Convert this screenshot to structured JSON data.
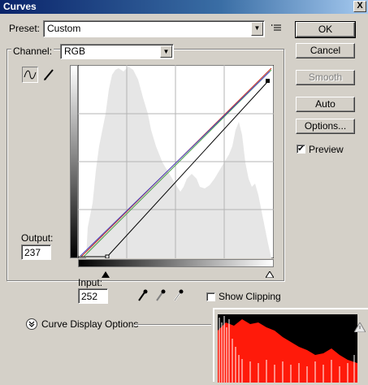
{
  "window": {
    "title": "Curves",
    "close_label": "X"
  },
  "preset": {
    "label": "Preset:",
    "value": "Custom"
  },
  "channel": {
    "label": "Channel:",
    "value": "RGB"
  },
  "buttons": {
    "ok": "OK",
    "cancel": "Cancel",
    "smooth": "Smooth",
    "auto": "Auto",
    "options": "Options..."
  },
  "preview": {
    "label": "Preview",
    "checked": true
  },
  "output": {
    "label": "Output:",
    "value": "237"
  },
  "input": {
    "label": "Input:",
    "value": "252"
  },
  "show_clipping": {
    "label": "Show Clipping",
    "checked": false
  },
  "curve_display_options": {
    "label": "Curve Display Options"
  },
  "colors": {
    "histogram": "#e6e6e6",
    "curve_red": "#c8321e",
    "curve_green": "#46a046",
    "curve_blue": "#4646c8",
    "overlay_red": "#ff1a0a"
  }
}
